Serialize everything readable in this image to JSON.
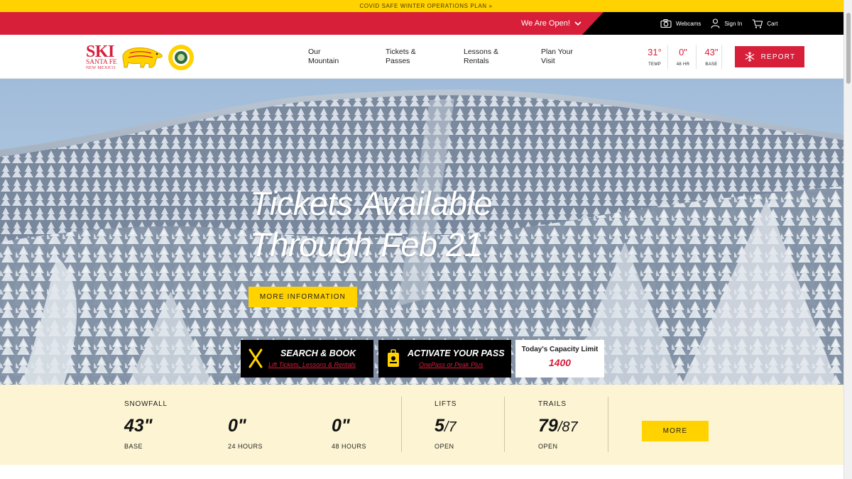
{
  "alert": {
    "text": "COVID SAFE WINTER OPERATIONS PLAN »"
  },
  "utility": {
    "status": "We Are Open!",
    "links": [
      {
        "label": "Webcams",
        "icon": "camera-icon"
      },
      {
        "label": "Sign In",
        "icon": "user-icon"
      },
      {
        "label": "Cart",
        "icon": "cart-icon"
      }
    ]
  },
  "logo": {
    "ski": "SKI",
    "name": "SANTA FE",
    "state": "NEW MEXICO"
  },
  "nav": [
    {
      "line1": "Our",
      "line2": "Mountain"
    },
    {
      "line1": "Tickets &",
      "line2": "Passes"
    },
    {
      "line1": "Lessons &",
      "line2": "Rentals"
    },
    {
      "line1": "Plan Your",
      "line2": "Visit"
    }
  ],
  "conditions": [
    {
      "value": "31°",
      "label": "TEMP"
    },
    {
      "value": "0\"",
      "label": "48 HR"
    },
    {
      "value": "43\"",
      "label": "BASE"
    }
  ],
  "report": {
    "label": "REPORT"
  },
  "hero": {
    "title_line1": "Tickets Available",
    "title_line2": "Through Feb 21",
    "button": "MORE INFORMATION"
  },
  "cta": [
    {
      "title": "SEARCH & BOOK",
      "sub": "Lift Tickets, Lessons & Rentals",
      "icon": "skis-icon"
    },
    {
      "title": "ACTIVATE YOUR PASS",
      "sub": "OnePass or Peak Plus",
      "icon": "pass-card-icon"
    }
  ],
  "capacity": {
    "label": "Today's Capacity Limit",
    "value": "1400"
  },
  "stats": {
    "snowfall": {
      "header": "SNOWFALL",
      "items": [
        {
          "value": "43\"",
          "label": "BASE"
        },
        {
          "value": "0\"",
          "label": "24 HOURS"
        },
        {
          "value": "0\"",
          "label": "48 HOURS"
        }
      ]
    },
    "lifts": {
      "header": "LIFTS",
      "open": "5",
      "total": "/7",
      "label": "OPEN"
    },
    "trails": {
      "header": "TRAILS",
      "open": "79",
      "total": "/87",
      "label": "OPEN"
    },
    "more": "MORE"
  },
  "colors": {
    "brand_red": "#d71f3a",
    "brand_yellow": "#ffd200",
    "stats_bg": "#fcf4d2"
  }
}
